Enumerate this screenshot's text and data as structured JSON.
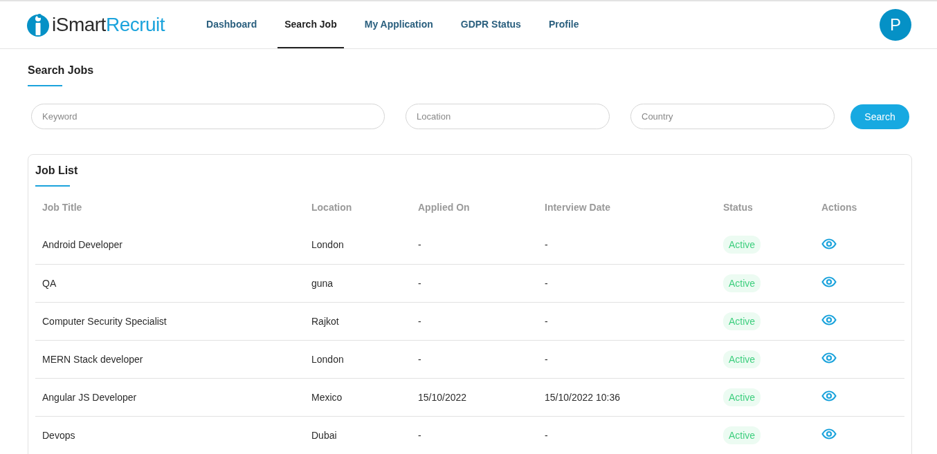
{
  "header": {
    "logo": [
      "iSmart",
      "Recruit"
    ],
    "nav": [
      {
        "label": "Dashboard",
        "selected": false
      },
      {
        "label": "Search Job",
        "selected": true
      },
      {
        "label": "My Application",
        "selected": false
      },
      {
        "label": "GDPR Status",
        "selected": false
      },
      {
        "label": "Profile",
        "selected": false
      }
    ],
    "avatar": "P"
  },
  "search": {
    "title": "Search Jobs",
    "fields": [
      {
        "placeholder": "Keyword"
      },
      {
        "placeholder": "Location"
      },
      {
        "placeholder": "Country"
      }
    ],
    "button": "Search"
  },
  "job_list": {
    "title": "Job List",
    "columns": [
      "Job Title",
      "Location",
      "Applied On",
      "Interview Date",
      "Status",
      "Actions"
    ],
    "rows": [
      {
        "title": "Android Developer",
        "location": "London",
        "applied_on": "-",
        "interview_date": "-",
        "status": "Active"
      },
      {
        "title": "QA",
        "location": "guna",
        "applied_on": "-",
        "interview_date": "-",
        "status": "Active"
      },
      {
        "title": "Computer Security Specialist",
        "location": "Rajkot",
        "applied_on": "-",
        "interview_date": "-",
        "status": "Active"
      },
      {
        "title": "MERN Stack developer",
        "location": "London",
        "applied_on": "-",
        "interview_date": "-",
        "status": "Active"
      },
      {
        "title": "Angular JS Developer",
        "location": "Mexico",
        "applied_on": "15/10/2022",
        "interview_date": "15/10/2022 10:36",
        "status": "Active"
      },
      {
        "title": "Devops",
        "location": "Dubai",
        "applied_on": "-",
        "interview_date": "-",
        "status": "Active"
      }
    ]
  }
}
